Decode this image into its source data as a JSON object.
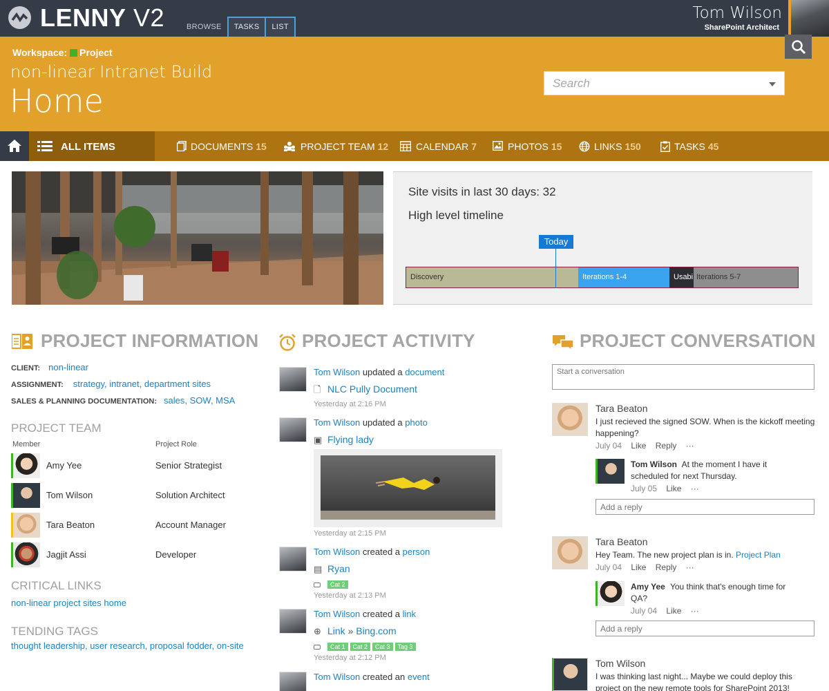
{
  "app": {
    "name_bold": "LENNY",
    "name_version": "V2",
    "ribbon_tabs": [
      "BROWSE",
      "TASKS",
      "LIST"
    ],
    "active_ribbon_tab": "TASKS",
    "user": {
      "name": "Tom Wilson",
      "title": "SharePoint Architect"
    }
  },
  "header": {
    "workspace_label": "Workspace:",
    "workspace_name": "Project",
    "site_title": "non-linear Intranet Build",
    "page_title": "Home",
    "search_placeholder": "Search"
  },
  "nav": {
    "all_items": "ALL ITEMS",
    "items": [
      {
        "label": "DOCUMENTS",
        "count": "15",
        "icon": "documents-icon"
      },
      {
        "label": "PROJECT TEAM",
        "count": "12",
        "icon": "team-icon"
      },
      {
        "label": "CALENDAR",
        "count": "7",
        "icon": "calendar-icon"
      },
      {
        "label": "PHOTOS",
        "count": "15",
        "icon": "photos-icon"
      },
      {
        "label": "LINKS",
        "count": "150",
        "icon": "links-icon"
      },
      {
        "label": "TASKS",
        "count": "45",
        "icon": "tasks-icon"
      }
    ]
  },
  "hero": {
    "visits": "Site visits in last 30 days: 32",
    "timeline_title": "High level timeline",
    "today_label": "Today",
    "segments": [
      "Discovery",
      "Iterations 1-4",
      "Usabi",
      "Iterations 5-7"
    ]
  },
  "info": {
    "heading": "PROJECT INFORMATION",
    "client_label": "CLIENT:",
    "client_value": "non-linear",
    "assignment_label": "ASSIGNMENT:",
    "assignment_value": "strategy, intranet, department sites",
    "sales_label": "SALES & PLANNING DOCUMENTATION:",
    "sales_value": "sales, SOW, MSA",
    "team_heading": "PROJECT TEAM",
    "col_member": "Member",
    "col_role": "Project Role",
    "team": [
      {
        "name": "Amy Yee",
        "role": "Senior Strategist"
      },
      {
        "name": "Tom Wilson",
        "role": "Solution Architect"
      },
      {
        "name": "Tara Beaton",
        "role": "Account Manager"
      },
      {
        "name": "Jagjit Assi",
        "role": "Developer"
      }
    ],
    "links_heading": "CRITICAL LINKS",
    "links_value": "non-linear project sites home",
    "tags_heading": "TENDING TAGS",
    "tags_value": "thought leadership, user research, proposal fodder, on-site"
  },
  "activity": {
    "heading": "PROJECT ACTIVITY",
    "items": [
      {
        "user": "Tom Wilson",
        "verb": "updated a",
        "kind": "document",
        "object": "NLC Pully Document",
        "time": "Yesterday at 2:16 PM"
      },
      {
        "user": "Tom Wilson",
        "verb": "updated a",
        "kind": "photo",
        "object": "Flying lady",
        "time": "Yesterday at 2:15 PM"
      },
      {
        "user": "Tom Wilson",
        "verb": "created a",
        "kind": "person",
        "object": "Ryan",
        "time": "Yesterday at 2:13 PM",
        "tags": [
          "Cat 2"
        ]
      },
      {
        "user": "Tom Wilson",
        "verb": "created a",
        "kind": "link",
        "object_prefix": "Link",
        "object_sep": "»",
        "object": "Bing.com",
        "time": "Yesterday at 2:12 PM",
        "tags": [
          "Cat 1",
          "Cat 2",
          "Cat 3",
          "Tag 3"
        ]
      },
      {
        "user": "Tom Wilson",
        "verb": "created an",
        "kind": "event"
      }
    ]
  },
  "conversation": {
    "heading": "PROJECT CONVERSATION",
    "start_placeholder": "Start a conversation",
    "like": "Like",
    "reply": "Reply",
    "more": "···",
    "add_reply_placeholder": "Add a reply",
    "posts": [
      {
        "author": "Tara Beaton",
        "text": "I just recieved the signed SOW. When is the kickoff meeting happening?",
        "date": "July 04",
        "reply": {
          "author": "Tom Wilson",
          "text": "At the moment I have it scheduled for next Thursday.",
          "date": "July 05"
        }
      },
      {
        "author": "Tara Beaton",
        "text": "Hey Team. The new project plan is in.",
        "link": "Project Plan",
        "date": "July 04",
        "reply": {
          "author": "Amy Yee",
          "text": "You think that's enough time for QA?",
          "date": "July 04"
        }
      },
      {
        "author": "Tom Wilson",
        "text": "I was thinking last night... Maybe we could deploy this project on the new remote tools for SharePoint 2013!"
      }
    ]
  }
}
